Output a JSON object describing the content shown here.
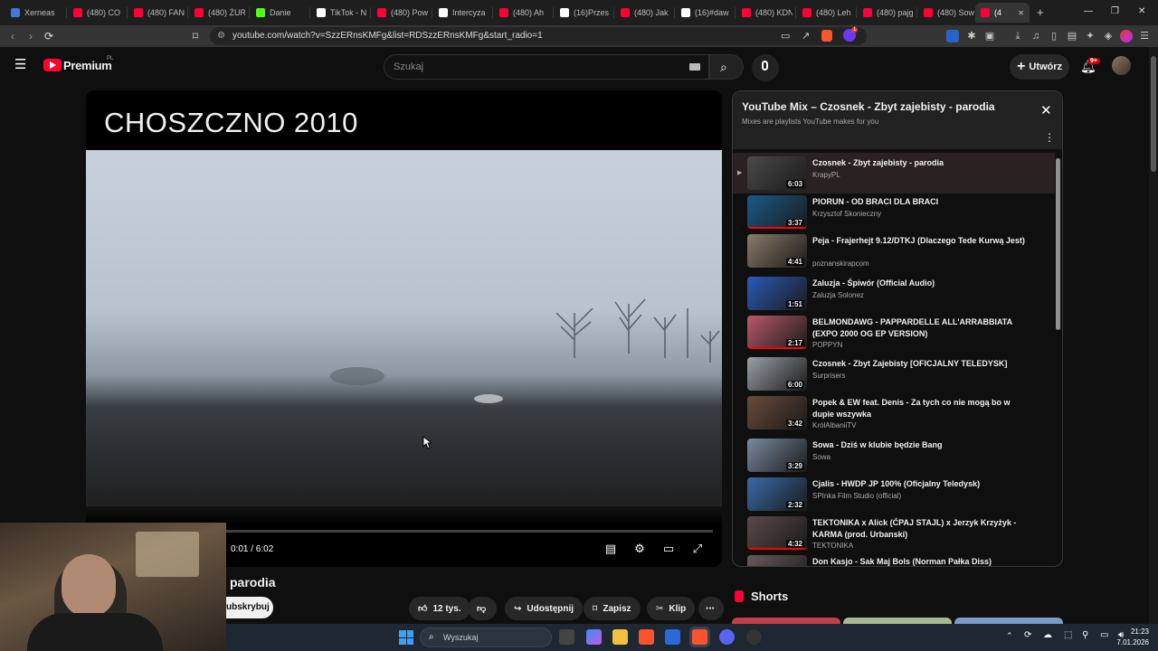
{
  "browser": {
    "tabs": [
      {
        "label": "Xerneas",
        "color": "#3d7bd8"
      },
      {
        "label": "(480) CO",
        "color": "#ff0033"
      },
      {
        "label": "(480) FAN",
        "color": "#ff0033"
      },
      {
        "label": "(480) ŻUR",
        "color": "#ff0033"
      },
      {
        "label": "Danie",
        "color": "#53fc18"
      },
      {
        "label": "TikTok - N",
        "color": "#ffffff"
      },
      {
        "label": "(480) Pow",
        "color": "#ff0033"
      },
      {
        "label": "Intercyza",
        "color": "#ffffff"
      },
      {
        "label": "(480) Ah",
        "color": "#ff0033"
      },
      {
        "label": "(16)Przes",
        "color": "#ffffff"
      },
      {
        "label": "(480) Jak",
        "color": "#ff0033"
      },
      {
        "label": "(16)#daw",
        "color": "#ffffff"
      },
      {
        "label": "(480) KDN",
        "color": "#ff0033"
      },
      {
        "label": "(480) Leh",
        "color": "#ff0033"
      },
      {
        "label": "(480) pajg",
        "color": "#ff0033"
      },
      {
        "label": "(480) Sow",
        "color": "#ff0033"
      },
      {
        "label": "(4",
        "color": "#ff0033"
      }
    ],
    "new_tab_symbol": "+",
    "url": "youtube.com/watch?v=SzzERnsKMFg&list=RDSzzERnsKMFg&start_radio=1",
    "extension_badge": "1"
  },
  "youtube": {
    "logo_text": "Premium",
    "logo_region": "PL",
    "search_placeholder": "Szukaj",
    "create_label": "Utwórz",
    "notif_badge": "9+"
  },
  "video": {
    "overlay_title": "CHOSZCZNO 2010",
    "current_time": "0:01 / 6:02",
    "progress_fraction": 0.003,
    "title_below": "parodia",
    "subscribe_label": "ubskrybuj",
    "likes": "12 tys.",
    "share_label": "Udostępnij",
    "save_label": "Zapisz",
    "clip_label": "Klip",
    "more_label": "⋯"
  },
  "playlist": {
    "title": "YouTube Mix – Czosnek - Zbyt zajebisty - parodia",
    "subtitle": "Mixes are playlists YouTube makes for you",
    "items": [
      {
        "title": "Czosnek - Zbyt zajebisty - parodia",
        "artist": "KrapyPL",
        "duration": "6:03",
        "thumb": "#4a4a4a",
        "current": true
      },
      {
        "title": "PIORUN - OD BRACI DLA BRACI",
        "artist": "Krzysztof Skonieczny",
        "duration": "3:37",
        "thumb": "#1a5a8a",
        "current": false
      },
      {
        "title": "Peja - Frajerhejt 9.12/DTKJ (Dlaczego Tede Kurwą Jest)",
        "artist": "poznanskirapcom",
        "duration": "4:41",
        "thumb": "#8a7a6a",
        "current": false
      },
      {
        "title": "Zaluzja - Śpiwór (Official Audio)",
        "artist": "Zaluzja Solonez",
        "duration": "1:51",
        "thumb": "#2a5ab8",
        "current": false
      },
      {
        "title": "BELMONDAWG - PAPPARDELLE ALL'ARRABBIATA (EXPO 2000 OG EP VERSION)",
        "artist": "POPPYN",
        "duration": "2:17",
        "thumb": "#b85a6a",
        "current": false
      },
      {
        "title": "Czosnek - Zbyt Zajebisty [OFICJALNY TELEDYSK]",
        "artist": "Surprisers",
        "duration": "6:00",
        "thumb": "#9aa0a8",
        "current": false
      },
      {
        "title": "Popek & EW feat. Denis - Za tych co nie mogą bo w dupie wszywka",
        "artist": "KrólAlbaniiTV",
        "duration": "3:42",
        "thumb": "#6a4a3a",
        "current": false
      },
      {
        "title": "Sowa - Dziś w klubie będzie Bang",
        "artist": "Sowa",
        "duration": "3:29",
        "thumb": "#7a8aa0",
        "current": false
      },
      {
        "title": "Cjalis - HWDP JP 100% (Oficjalny Teledysk)",
        "artist": "SPInka Film Studio (official)",
        "duration": "2:32",
        "thumb": "#3a6aa8",
        "current": false
      },
      {
        "title": "TEKTONIKA x Alick (ĆPAJ STAJL) x Jerzyk Krzyżyk - KARMA (prod. Urbanski)",
        "artist": "TEKTONIKA",
        "duration": "4:32",
        "thumb": "#5a4a4a",
        "current": false
      },
      {
        "title": "Don Kasjo - Sak Maj Bols (Norman Pałka Diss)",
        "artist": "",
        "duration": "",
        "thumb": "#6a5a5a",
        "current": false
      }
    ]
  },
  "shorts_title": "Shorts",
  "taskbar": {
    "search_placeholder": "Wyszukaj",
    "time": "21:23",
    "date": "7.01.2026"
  }
}
